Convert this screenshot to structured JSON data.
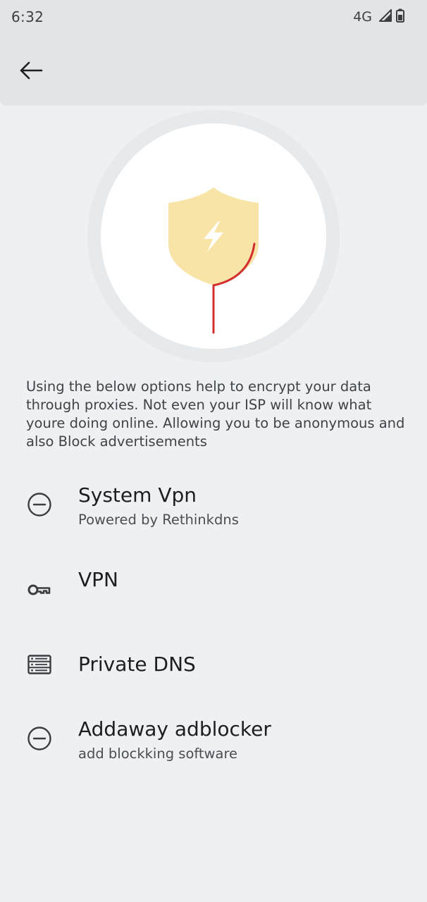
{
  "status_bar": {
    "time": "6:32",
    "network": "4G",
    "icons": [
      "signal-icon",
      "battery-icon"
    ]
  },
  "app_bar": {
    "back_icon": "arrow-back-icon"
  },
  "hero": {
    "icon": "shield-lightning-icon",
    "colors": {
      "shield": "#f7e4a6",
      "line": "#d32f2f"
    }
  },
  "description": "Using the below options help to encrypt your data through proxies. Not even your ISP will know what youre doing online. Allowing you to be anonymous and also Block advertisements",
  "options": [
    {
      "icon": "minus-circle-icon",
      "title": "System Vpn",
      "subtitle": "Powered by Rethinkdns"
    },
    {
      "icon": "vpn-key-icon",
      "title": "VPN",
      "subtitle": ""
    },
    {
      "icon": "dns-icon",
      "title": "Private DNS",
      "subtitle": ""
    },
    {
      "icon": "minus-circle-icon",
      "title": "Addaway adblocker",
      "subtitle": "add blockking software"
    }
  ]
}
